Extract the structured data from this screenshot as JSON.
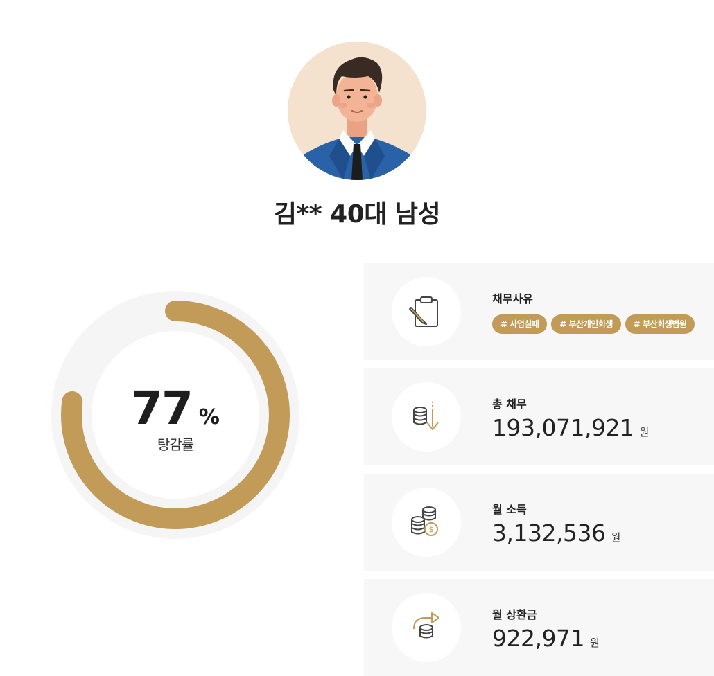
{
  "profile": {
    "title": "김** 40대 남성",
    "avatar_icon": "male-avatar-icon"
  },
  "reduction": {
    "value": "77",
    "unit": "%",
    "label": "탕감률",
    "fraction": 0.77
  },
  "colors": {
    "accent": "#c19b57",
    "card_bg": "#f7f7f7",
    "ring_track": "#f5f5f5"
  },
  "cards": {
    "reason": {
      "icon": "clipboard-pencil-icon",
      "label": "채무사유",
      "tags": [
        "# 사업실패",
        "# 부산개인회생",
        "# 부산회생법원"
      ]
    },
    "total_debt": {
      "icon": "coins-down-arrow-icon",
      "label": "총 채무",
      "value": "193,071,921",
      "unit": "원"
    },
    "monthly_income": {
      "icon": "coin-stack-icon",
      "label": "월 소득",
      "value": "3,132,536",
      "unit": "원"
    },
    "monthly_repayment": {
      "icon": "coins-return-arrow-icon",
      "label": "월 상환금",
      "value": "922,971",
      "unit": "원"
    }
  }
}
